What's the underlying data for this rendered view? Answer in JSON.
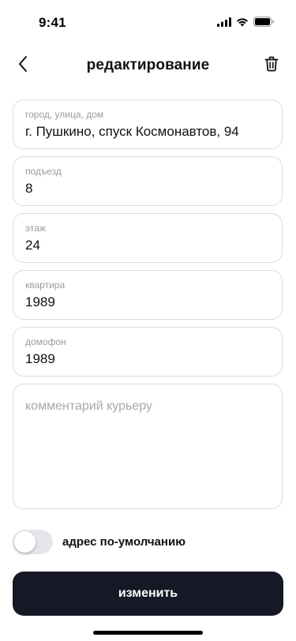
{
  "status_bar": {
    "time": "9:41"
  },
  "header": {
    "title": "редактирование",
    "back_icon": "chevron-left-icon",
    "delete_icon": "trash-icon"
  },
  "fields": {
    "address": {
      "label": "город, улица, дом",
      "value": "г. Пушкино, спуск Космонавтов, 94"
    },
    "entrance": {
      "label": "подъезд",
      "value": "8"
    },
    "floor": {
      "label": "этаж",
      "value": "24"
    },
    "apartment": {
      "label": "квартира",
      "value": "1989"
    },
    "intercom": {
      "label": "домофон",
      "value": "1989"
    },
    "comment": {
      "placeholder": "комментарий курьеру",
      "value": ""
    }
  },
  "default_toggle": {
    "label": "адрес по-умолчанию",
    "checked": false
  },
  "submit": {
    "label": "изменить"
  },
  "colors": {
    "primary_button": "#161826",
    "field_border": "#dcdcdf",
    "label_gray": "#9a9aa0",
    "toggle_off": "#e6e6ea"
  }
}
